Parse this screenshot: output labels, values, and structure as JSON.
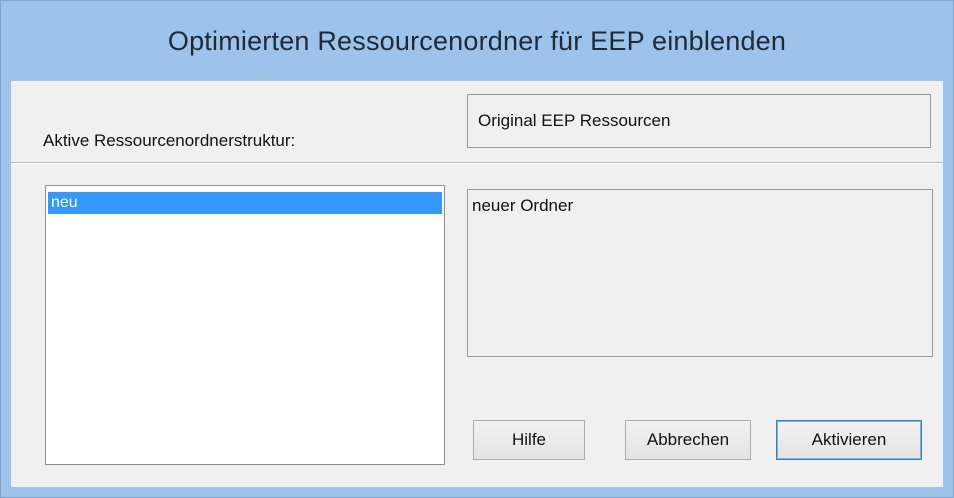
{
  "window": {
    "title": "Optimierten Ressourcenordner für EEP einblenden"
  },
  "structure": {
    "label": "Aktive Ressourcenordnerstruktur:",
    "value": "Original EEP Ressourcen"
  },
  "folder_list": {
    "items": [
      {
        "label": "neu",
        "selected": true
      }
    ]
  },
  "description": {
    "text": "neuer Ordner"
  },
  "buttons": {
    "help_label": "Hilfe",
    "cancel_label": "Abbrechen",
    "activate_label": "Aktivieren"
  },
  "colors": {
    "title_bar": "#9ec3ea",
    "selection": "#3399ff",
    "client_background": "#f0f0f0"
  }
}
